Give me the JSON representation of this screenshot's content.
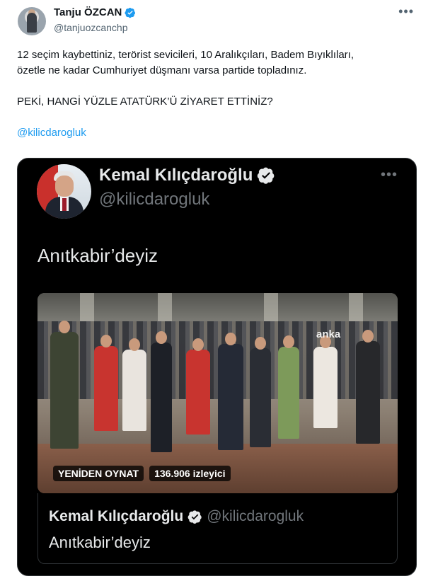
{
  "author": {
    "name": "Tanju ÖZCAN",
    "handle": "@tanjuozcanchp",
    "verified_color": "#1d9bf0"
  },
  "menu_glyph": "•••",
  "tweet": {
    "line1": "12 seçim kaybettiniz, terörist sevicileri, 10 Aralıkçıları, Badem Bıyıklıları,",
    "line2": "özetle ne kadar Cumhuriyet düşmanı varsa partide topladınız.",
    "line3": "PEKİ, HANGİ YÜZLE ATATÜRK’Ü ZİYARET ETTİNİZ?",
    "mention": "@kilicdarogluk"
  },
  "embedded": {
    "name": "Kemal Kılıçdaroğlu",
    "handle": "@kilicdarogluk",
    "text": "Anıtkabir’deyiz",
    "video": {
      "watermark": "anka",
      "replay_label": "YENİDEN OYNAT",
      "viewers": "136.906 izleyici"
    },
    "footer": {
      "name": "Kemal Kılıçdaroğlu",
      "handle": "@kilicdarogluk",
      "text": "Anıtkabir’deyiz"
    }
  }
}
